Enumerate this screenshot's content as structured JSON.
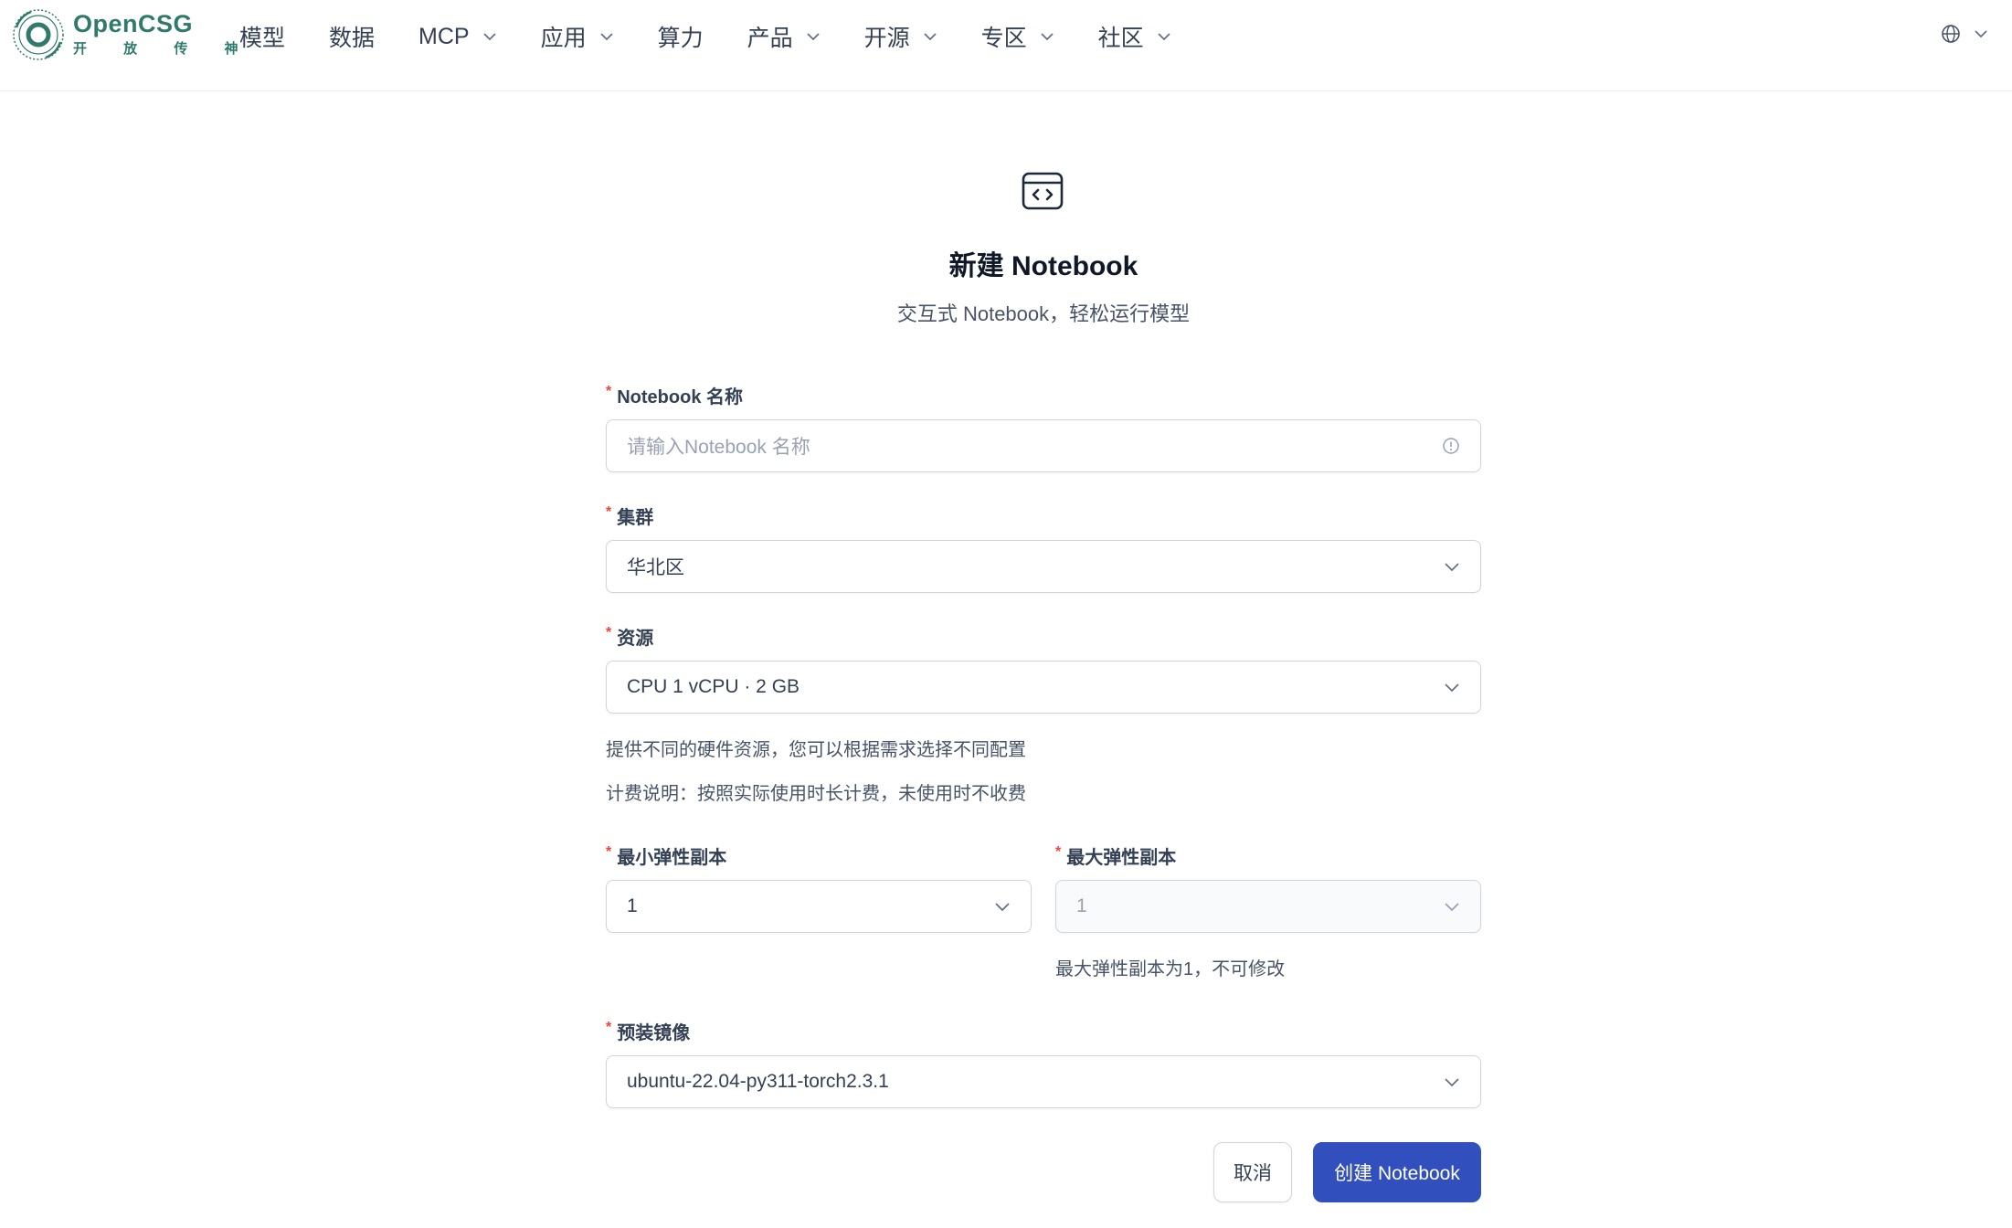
{
  "brand": {
    "name": "OpenCSG",
    "tagline": "开 放 传 神",
    "color": "#2f7a6b"
  },
  "nav": {
    "items": [
      {
        "label": "模型",
        "has_dropdown": false
      },
      {
        "label": "数据",
        "has_dropdown": false
      },
      {
        "label": "MCP",
        "has_dropdown": true
      },
      {
        "label": "应用",
        "has_dropdown": true
      },
      {
        "label": "算力",
        "has_dropdown": false
      },
      {
        "label": "产品",
        "has_dropdown": true
      },
      {
        "label": "开源",
        "has_dropdown": true
      },
      {
        "label": "专区",
        "has_dropdown": true
      },
      {
        "label": "社区",
        "has_dropdown": true
      }
    ],
    "language_icon": "globe-icon"
  },
  "page": {
    "icon": "code-window-icon",
    "title": "新建 Notebook",
    "subtitle": "交互式 Notebook，轻松运行模型"
  },
  "form": {
    "required_mark": "*",
    "name": {
      "label": "Notebook 名称",
      "placeholder": "请输入Notebook 名称",
      "value": "",
      "icon": "info-circle-icon"
    },
    "cluster": {
      "label": "集群",
      "value": "华北区"
    },
    "resource": {
      "label": "资源",
      "value": "CPU 1 vCPU · 2 GB",
      "help": "提供不同的硬件资源，您可以根据需求选择不同配置",
      "billing": "计费说明：按照实际使用时长计费，未使用时不收费"
    },
    "min_replicas": {
      "label": "最小弹性副本",
      "value": "1"
    },
    "max_replicas": {
      "label": "最大弹性副本",
      "value": "1",
      "disabled": true,
      "help": "最大弹性副本为1，不可修改"
    },
    "image": {
      "label": "预装镜像",
      "value": "ubuntu-22.04-py311-torch2.3.1"
    }
  },
  "actions": {
    "cancel_label": "取消",
    "submit_label": "创建 Notebook",
    "primary_color": "#3250bd"
  }
}
